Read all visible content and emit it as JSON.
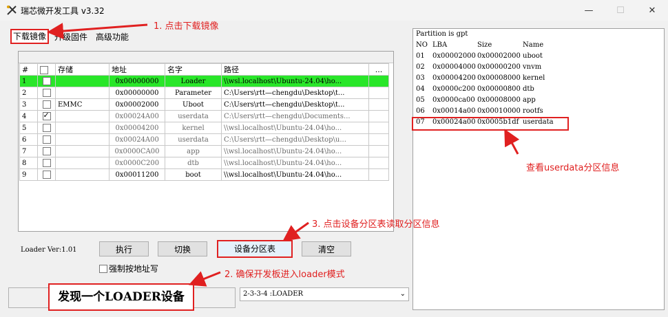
{
  "window": {
    "title": "瑞芯微开发工具 v3.32"
  },
  "tabs": [
    "下载镜像",
    "升级固件",
    "高级功能"
  ],
  "grid": {
    "headers": [
      "#",
      "",
      "存储",
      "地址",
      "名字",
      "路径",
      "..."
    ],
    "rows": [
      {
        "num": "1",
        "checked": false,
        "storage": "",
        "address": "0x00000000",
        "name": "Loader",
        "path": "\\\\wsl.localhost\\Ubuntu-24.04\\ho...",
        "highlight": true,
        "gray": false
      },
      {
        "num": "2",
        "checked": false,
        "storage": "",
        "address": "0x00000000",
        "name": "Parameter",
        "path": "C:\\Users\\rtt—chengdu\\Desktop\\t...",
        "highlight": false,
        "gray": false
      },
      {
        "num": "3",
        "checked": false,
        "storage": "EMMC",
        "address": "0x00002000",
        "name": "Uboot",
        "path": "C:\\Users\\rtt—chengdu\\Desktop\\t...",
        "highlight": false,
        "gray": false
      },
      {
        "num": "4",
        "checked": true,
        "storage": "",
        "address": "0x00024A00",
        "name": "userdata",
        "path": "C:\\Users\\rtt—chengdu\\Documents...",
        "highlight": false,
        "gray": true
      },
      {
        "num": "5",
        "checked": false,
        "storage": "",
        "address": "0x00004200",
        "name": "kernel",
        "path": "\\\\wsl.localhost\\Ubuntu-24.04\\ho...",
        "highlight": false,
        "gray": true
      },
      {
        "num": "6",
        "checked": false,
        "storage": "",
        "address": "0x00024A00",
        "name": "userdata",
        "path": "C:\\Users\\rtt—chengdu\\Desktop\\u...",
        "highlight": false,
        "gray": true
      },
      {
        "num": "7",
        "checked": false,
        "storage": "",
        "address": "0x0000CA00",
        "name": "app",
        "path": "\\\\wsl.localhost\\Ubuntu-24.04\\ho...",
        "highlight": false,
        "gray": true
      },
      {
        "num": "8",
        "checked": false,
        "storage": "",
        "address": "0x0000C200",
        "name": "dtb",
        "path": "\\\\wsl.localhost\\Ubuntu-24.04\\ho...",
        "highlight": false,
        "gray": true
      },
      {
        "num": "9",
        "checked": false,
        "storage": "",
        "address": "0x00011200",
        "name": "boot",
        "path": "\\\\wsl.localhost\\Ubuntu-24.04\\ho...",
        "highlight": false,
        "gray": false
      }
    ]
  },
  "bottom": {
    "loader_ver": "Loader Ver:1.01",
    "execute_label": "执行",
    "switch_label": "切换",
    "partition_table_label": "设备分区表",
    "clear_label": "清空",
    "force_write_label": "强制按地址写",
    "status_text": "发现一个LOADER设备",
    "device_select": "2-3-3-4 :LOADER"
  },
  "partition": {
    "title": "Partition is gpt",
    "headers": [
      "NO",
      "LBA",
      "Size",
      "Name"
    ],
    "rows": [
      {
        "no": "01",
        "lba": "0x00002000",
        "size": "0x00002000",
        "name": "uboot"
      },
      {
        "no": "02",
        "lba": "0x00004000",
        "size": "0x00000200",
        "name": "vnvm"
      },
      {
        "no": "03",
        "lba": "0x00004200",
        "size": "0x00008000",
        "name": "kernel"
      },
      {
        "no": "04",
        "lba": "0x0000c200",
        "size": "0x00000800",
        "name": "dtb"
      },
      {
        "no": "05",
        "lba": "0x0000ca00",
        "size": "0x00008000",
        "name": "app"
      },
      {
        "no": "06",
        "lba": "0x00014a00",
        "size": "0x00010000",
        "name": "rootfs"
      },
      {
        "no": "07",
        "lba": "0x00024a00",
        "size": "0x0005b1df",
        "name": "userdata"
      }
    ]
  },
  "annotations": {
    "step1": "1. 点击下载镜像",
    "step2": "2. 确保开发板进入loader模式",
    "step3": "3. 点击设备分区表读取分区信息",
    "view_userdata": "查看userdata分区信息"
  },
  "colors": {
    "annotation": "#e02020",
    "highlight_row": "#29e629"
  }
}
